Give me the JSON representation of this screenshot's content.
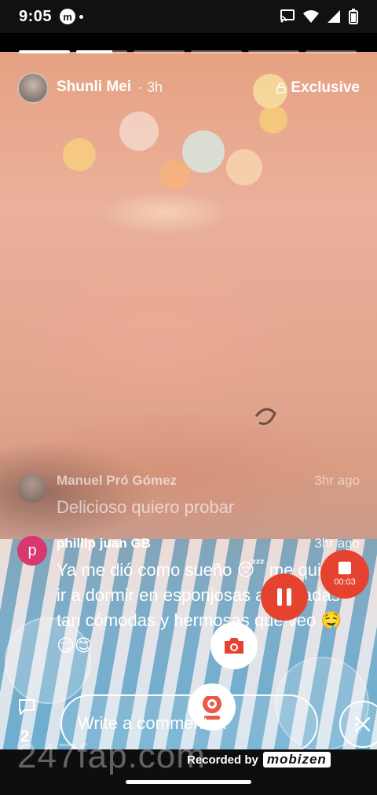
{
  "status_bar": {
    "time": "9:05",
    "app_badge": "m"
  },
  "story": {
    "progress_segments": [
      1.0,
      0.7,
      0,
      0,
      0,
      0
    ],
    "user": {
      "name": "Shunli Mei",
      "posted_ago": "· 3h",
      "badge": "Exclusive"
    }
  },
  "comments": [
    {
      "name": "Manuel Pró Gómez",
      "ago": "3hr ago",
      "text": "Delicioso quiero probar",
      "avatar_letter": ""
    },
    {
      "name": "phillip juan GB",
      "ago": "3hr ago",
      "text": "Ya me dió como sueño 😴 me quiero ir a dormir en esponjosas almohadas tan cómodas y hermosas que veo 🤤 😏😊",
      "avatar_letter": "p"
    }
  ],
  "recorder": {
    "timer": "00:03",
    "recorded_by": "Recorded by",
    "brand": "mobizen"
  },
  "composer": {
    "comment_count": "2",
    "placeholder": "Write a comment ..."
  },
  "watermark": "247fap.com",
  "colors": {
    "record_red": "#e5432f",
    "avatar_pink": "#d6386f"
  }
}
